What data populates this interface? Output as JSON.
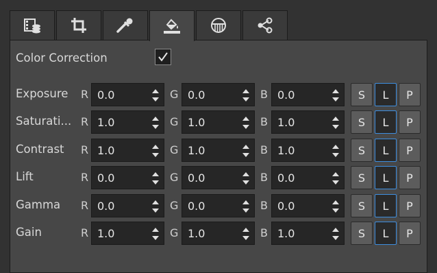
{
  "tabs": [
    {
      "icon": "film-reel-icon",
      "active": false
    },
    {
      "icon": "crop-icon",
      "active": false
    },
    {
      "icon": "eyedropper-icon",
      "active": false
    },
    {
      "icon": "paint-bucket-icon",
      "active": true
    },
    {
      "icon": "grille-mask-icon",
      "active": false
    },
    {
      "icon": "node-graph-icon",
      "active": false
    }
  ],
  "color_correction": {
    "label": "Color Correction",
    "checked": true
  },
  "channels": {
    "r": "R",
    "g": "G",
    "b": "B"
  },
  "buttons": {
    "s": "S",
    "l": "L",
    "p": "P"
  },
  "rows": [
    {
      "label": "Exposure",
      "r": "0.0",
      "g": "0.0",
      "b": "0.0"
    },
    {
      "label": "Saturati...",
      "r": "1.0",
      "g": "1.0",
      "b": "1.0"
    },
    {
      "label": "Contrast",
      "r": "1.0",
      "g": "1.0",
      "b": "1.0"
    },
    {
      "label": "Lift",
      "r": "0.0",
      "g": "0.0",
      "b": "0.0"
    },
    {
      "label": "Gamma",
      "r": "0.0",
      "g": "0.0",
      "b": "0.0"
    },
    {
      "label": "Gain",
      "r": "1.0",
      "g": "1.0",
      "b": "1.0"
    }
  ]
}
